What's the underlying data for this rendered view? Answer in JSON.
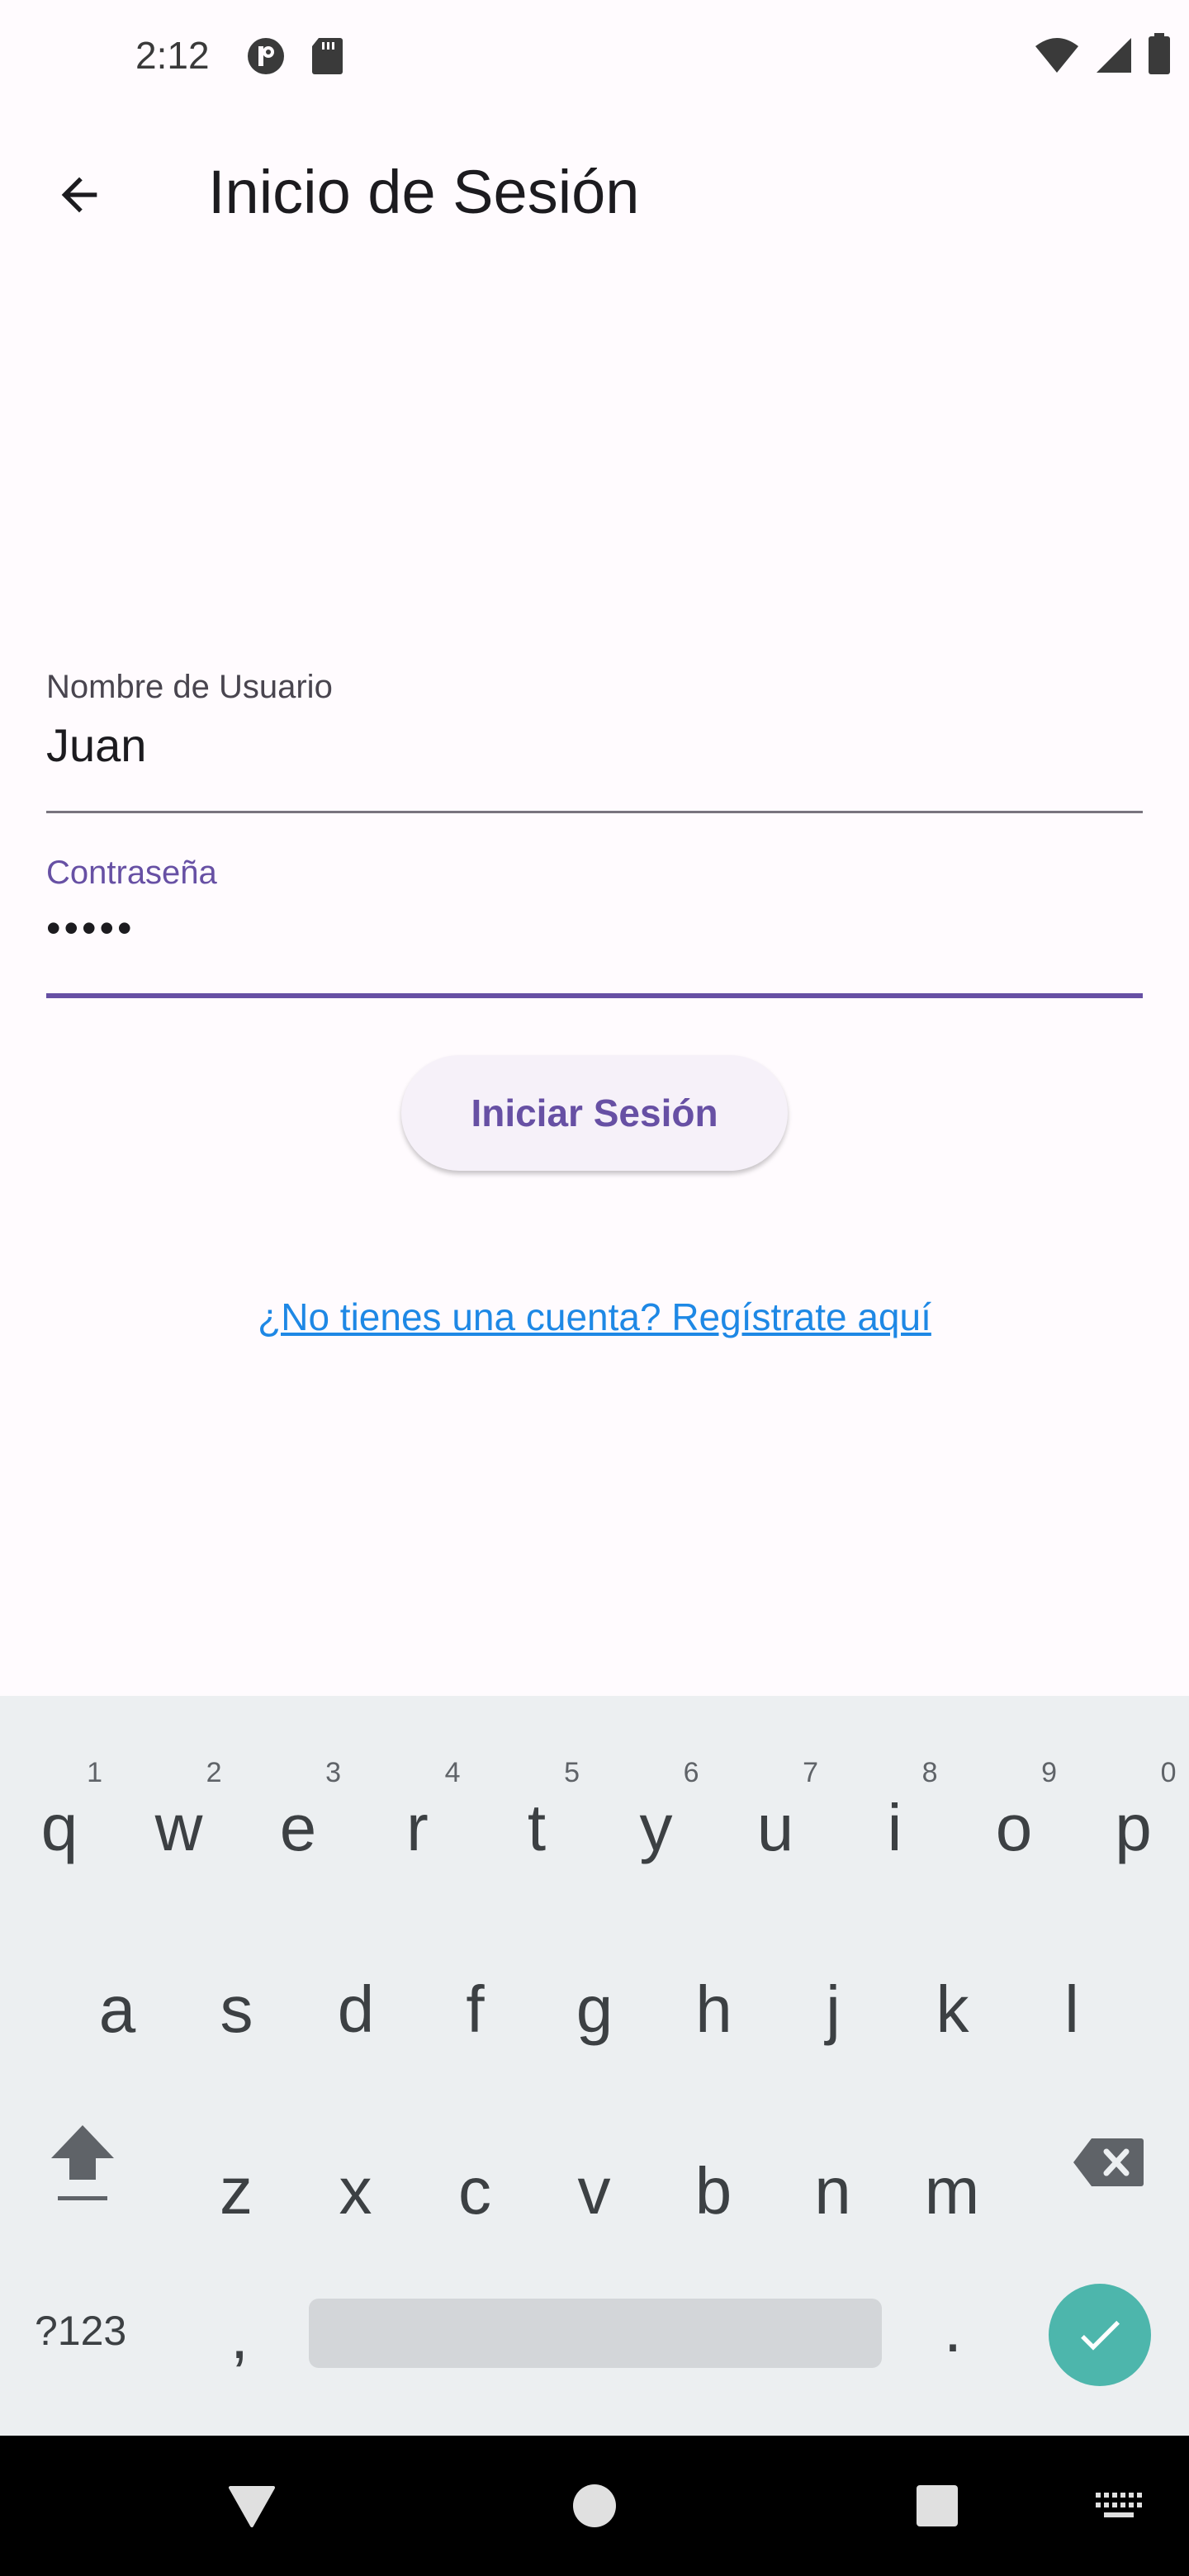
{
  "status_bar": {
    "time": "2:12",
    "left_icons": [
      "notification-p-icon",
      "sd-card-icon"
    ],
    "right_icons": [
      "wifi-icon",
      "cell-signal-icon",
      "battery-icon"
    ]
  },
  "app_bar": {
    "title": "Inicio de Sesión",
    "back_icon": "arrow-back-icon"
  },
  "form": {
    "username_label": "Nombre de Usuario",
    "username_value": "Juan",
    "password_label": "Contraseña",
    "password_value": "•••••",
    "login_button": "Iniciar Sesión",
    "register_link": "¿No tienes una cuenta? Regístrate aquí"
  },
  "keyboard": {
    "row1": [
      {
        "key": "q",
        "hint": "1"
      },
      {
        "key": "w",
        "hint": "2"
      },
      {
        "key": "e",
        "hint": "3"
      },
      {
        "key": "r",
        "hint": "4"
      },
      {
        "key": "t",
        "hint": "5"
      },
      {
        "key": "y",
        "hint": "6"
      },
      {
        "key": "u",
        "hint": "7"
      },
      {
        "key": "i",
        "hint": "8"
      },
      {
        "key": "o",
        "hint": "9"
      },
      {
        "key": "p",
        "hint": "0"
      }
    ],
    "row2": [
      "a",
      "s",
      "d",
      "f",
      "g",
      "h",
      "j",
      "k",
      "l"
    ],
    "row3": [
      "z",
      "x",
      "c",
      "v",
      "b",
      "n",
      "m"
    ],
    "symbols_key": "?123",
    "comma_key": ",",
    "period_key": "."
  },
  "colors": {
    "primary": "#6750a4",
    "link": "#1e88e5",
    "enter_key": "#4db6ac",
    "background": "#fffbfe",
    "keyboard_bg": "#eceff1"
  }
}
